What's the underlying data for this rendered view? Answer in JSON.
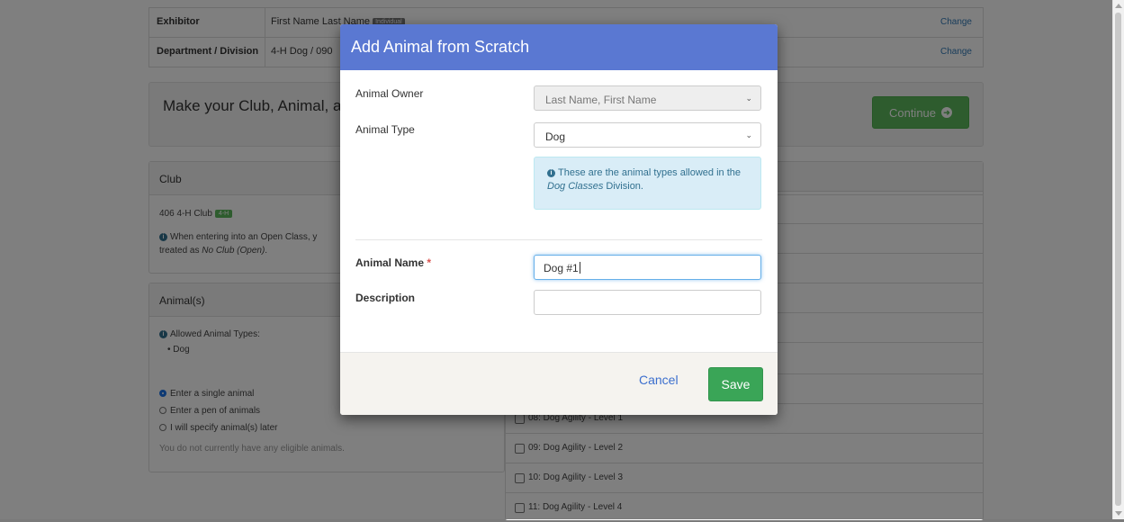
{
  "exhibitor_table": {
    "exhibitor_label": "Exhibitor",
    "exhibitor_value": "First Name Last Name",
    "exhibitor_badge": "Individual",
    "division_label": "Department / Division",
    "division_value": "4-H Dog / 090",
    "change_label": "Change"
  },
  "prompt": {
    "text": "Make your Club, Animal, a",
    "continue_label": "Continue"
  },
  "club_panel": {
    "title": "Club",
    "club_name": "406 4-H Club",
    "club_badge": "4-H",
    "note_line1": "When entering into an Open Class, y",
    "note_line2_prefix": "treated as ",
    "note_line2_em": "No Club (Open)",
    "note_line2_suffix": "."
  },
  "animals_panel": {
    "title": "Animal(s)",
    "allowed_label": "Allowed Animal Types:",
    "allowed_types": [
      "Dog"
    ],
    "options": [
      {
        "label": "Enter a single animal",
        "checked": true
      },
      {
        "label": "Enter a pen of animals",
        "checked": false
      },
      {
        "label": "I will specify animal(s) later",
        "checked": false
      }
    ],
    "no_animals_text": "You do not currently have any eligible animals."
  },
  "classes": [
    "08: Dog Agility - Level 1",
    "09: Dog Agility - Level 2",
    "10: Dog Agility - Level 3",
    "11: Dog Agility - Level 4"
  ],
  "modal": {
    "title": "Add Animal from Scratch",
    "owner_label": "Animal Owner",
    "owner_value": "Last Name, First Name",
    "type_label": "Animal Type",
    "type_value": "Dog",
    "alert_line1": "These are the animal types allowed in the",
    "alert_em": "Dog Classes",
    "alert_suffix": " Division.",
    "name_label": "Animal Name",
    "name_required": "*",
    "name_value": "Dog #1",
    "description_label": "Description",
    "description_value": "",
    "cancel_label": "Cancel",
    "save_label": "Save"
  },
  "colors": {
    "modal_header": "#5a78d2",
    "save_button": "#3aa557",
    "continue_button": "#5cb85c",
    "alert_bg": "#d9edf7"
  }
}
